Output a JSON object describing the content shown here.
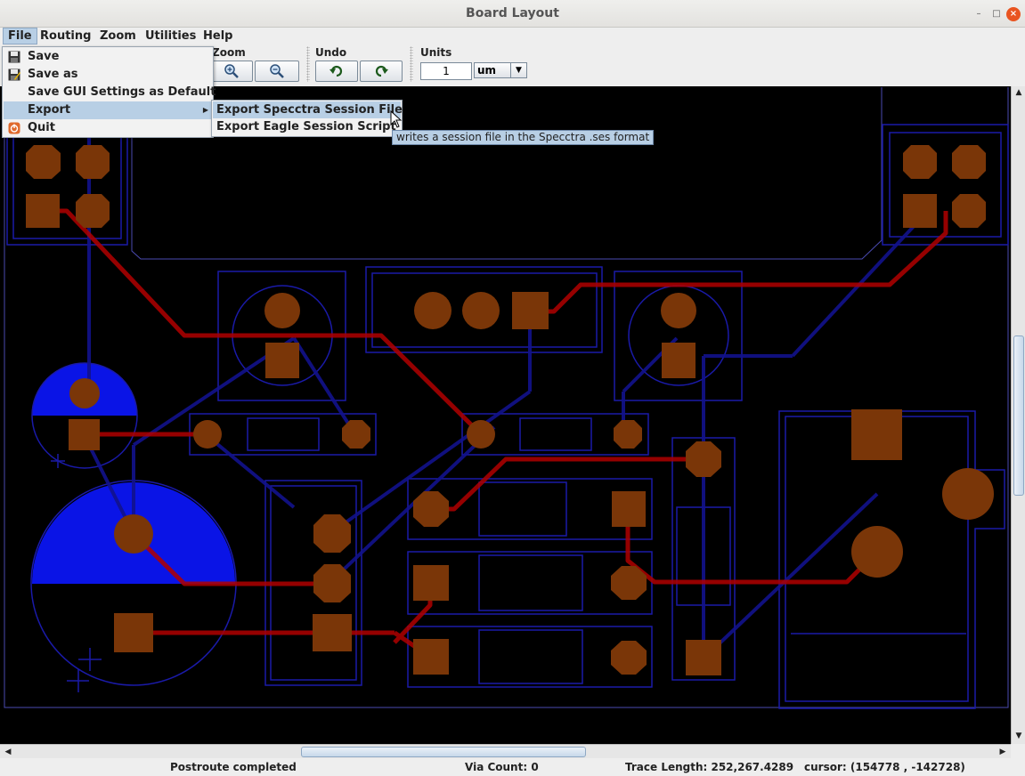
{
  "window": {
    "title": "Board Layout"
  },
  "menubar": {
    "items": [
      "File",
      "Routing",
      "Zoom",
      "Utilities",
      "Help"
    ]
  },
  "toolbar": {
    "zoom_label": "Zoom",
    "undo_label": "Undo",
    "units_label": "Units",
    "units_value": "1",
    "units_unit": "um"
  },
  "file_menu": {
    "items": [
      {
        "label": "Save",
        "icon": "floppy-icon"
      },
      {
        "label": "Save as",
        "icon": "floppy-edit-icon"
      },
      {
        "label": "Save GUI Settings as Default",
        "icon": ""
      },
      {
        "label": "Export",
        "icon": "",
        "submenu": true
      },
      {
        "label": "Quit",
        "icon": "quit-icon"
      }
    ]
  },
  "export_submenu": {
    "items": [
      "Export Specctra Session File",
      "Export Eagle Session Script"
    ]
  },
  "tooltip": {
    "text": "writes a session file in the Specctra .ses format"
  },
  "status": {
    "message": "Postroute completed",
    "via_count": "Via Count: 0",
    "trace_length": "Trace Length: 252,267.4289",
    "cursor": "cursor: (154778 , -142728)"
  },
  "colors": {
    "board_bg": "#000000",
    "pad": "#7a3608",
    "trace": "#b00000",
    "outline": "#1a1aa8",
    "copper_fill": "#0a14e6"
  }
}
